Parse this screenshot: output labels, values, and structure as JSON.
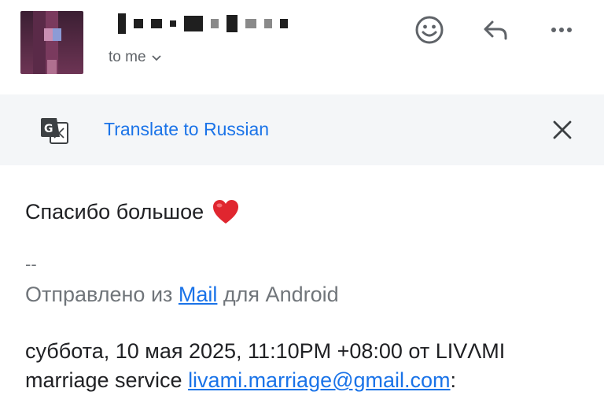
{
  "header": {
    "to_label": "to me",
    "icons": [
      "avatar",
      "emoji-icon",
      "reply-icon",
      "more-icon"
    ]
  },
  "translate_bar": {
    "link_label": "Translate to Russian",
    "icons": [
      "google-translate-icon",
      "close-icon"
    ]
  },
  "message": {
    "greeting": "Спасибо большое",
    "signature_separator": "--",
    "signature_prefix": "Отправлено из ",
    "signature_link": "Mail",
    "signature_suffix": " для Android",
    "quote_line1": "суббота, 10 мая 2025, 11:10PM +08:00 от LIVΛMI",
    "quote_line2_prefix": "marriage service ",
    "quote_email": "livami.marriage@gmail.com",
    "quote_line2_suffix": ":"
  },
  "colors": {
    "link": "#1a73e8",
    "translate_bar_bg": "#f4f6f8",
    "muted_text": "#70757a",
    "heart": "#e0262f"
  }
}
